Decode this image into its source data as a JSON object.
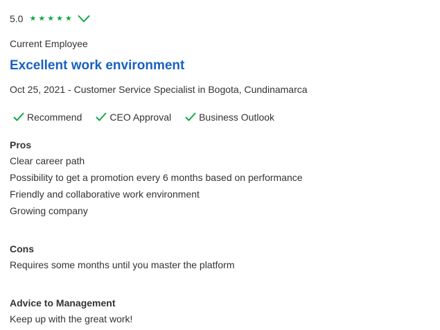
{
  "rating": {
    "value": "5.0",
    "stars_filled": 5,
    "stars_total": 5,
    "star_color": "#0caa41",
    "check_color": "#0caa41"
  },
  "employee_status": "Current Employee",
  "title": "Excellent work environment",
  "title_color": "#1861bf",
  "meta": "Oct 25, 2021 - Customer Service Specialist in Bogota, Cundinamarca",
  "indicators": [
    {
      "label": "Recommend",
      "icon": "check-icon"
    },
    {
      "label": "CEO Approval",
      "icon": "check-icon"
    },
    {
      "label": "Business Outlook",
      "icon": "check-icon"
    }
  ],
  "pros": {
    "heading": "Pros",
    "lines": [
      "Clear career path",
      "Possibility to get a promotion every 6 months based on performance",
      "Friendly and collaborative work environment",
      "Growing company"
    ]
  },
  "cons": {
    "heading": "Cons",
    "lines": [
      "Requires some months until you master the platform"
    ]
  },
  "advice": {
    "heading": "Advice to Management",
    "lines": [
      "Keep up with the great work!"
    ]
  }
}
